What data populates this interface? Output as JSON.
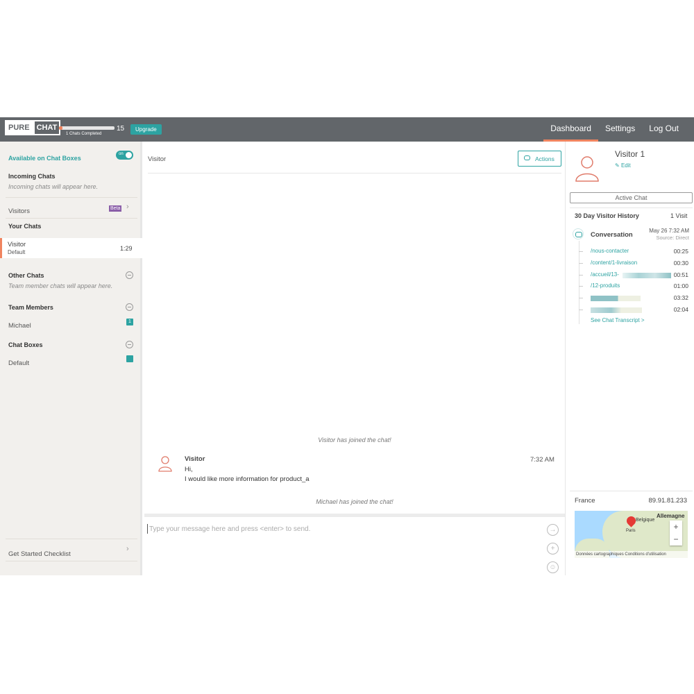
{
  "topbar": {
    "logo_pure": "PURE",
    "logo_chat": "CHAT",
    "progress_label": "1 Chats Completed",
    "progress_fraction": 0.067,
    "progress_count": "15",
    "upgrade_label": "Upgrade",
    "nav": [
      "Dashboard",
      "Settings",
      "Log Out"
    ],
    "accent_color": "#f0845f",
    "brand_color": "#2da3a2"
  },
  "sidebar": {
    "availability_label": "Available on Chat Boxes",
    "toggle_label": "on",
    "incoming_title": "Incoming Chats",
    "incoming_sub": "Incoming chats will appear here.",
    "visitors_label": "Visitors",
    "visitors_badge": "Beta",
    "your_chats_title": "Your Chats",
    "active_chat_name": "Visitor",
    "active_chat_box": "Default",
    "active_chat_time": "1:29",
    "other_chats_title": "Other Chats",
    "other_chats_sub": "Team member chats will appear here.",
    "team_title": "Team Members",
    "team_member": "Michael",
    "team_member_badge": "1",
    "chat_boxes_title": "Chat Boxes",
    "chat_box_name": "Default",
    "checklist_label": "Get Started Checklist"
  },
  "chat": {
    "header_label": "Visitor",
    "actions_label": "Actions",
    "joined_visitor": "Visitor has joined the chat!",
    "message_sender": "Visitor",
    "message_time": "7:32 AM",
    "message_line1": "Hi,",
    "message_line2": "I would like more information for product_a",
    "joined_agent": "Michael has joined the chat!",
    "composer_placeholder": "Type your message here and press <enter> to send."
  },
  "visitor_panel": {
    "name": "Visitor 1",
    "edit_label": "Edit",
    "active_chat_label": "Active Chat",
    "history_title": "30 Day Visitor History",
    "history_count": "1 Visit",
    "conversation_title": "Conversation",
    "conversation_date": "May 26 7:32 AM",
    "conversation_source": "Source: Direct",
    "pages": [
      {
        "path": "/nous-contacter",
        "time": "00:25"
      },
      {
        "path": "/content/1-livraison",
        "time": "00:30"
      },
      {
        "path": "/accueil/13-",
        "time": "00:51"
      },
      {
        "path": "/12-produits",
        "time": "01:00"
      },
      {
        "path": "",
        "time": "03:32"
      },
      {
        "path": "",
        "time": "02:04"
      }
    ],
    "transcript_link": "See Chat Transcript >",
    "country": "France",
    "ip": "89.91.81.233",
    "map_labels": {
      "country_a": "Allemagne",
      "country_b": "Belgique",
      "city": "Paris"
    },
    "map_attribution": "Données cartographiques    Conditions d'utilisation"
  }
}
